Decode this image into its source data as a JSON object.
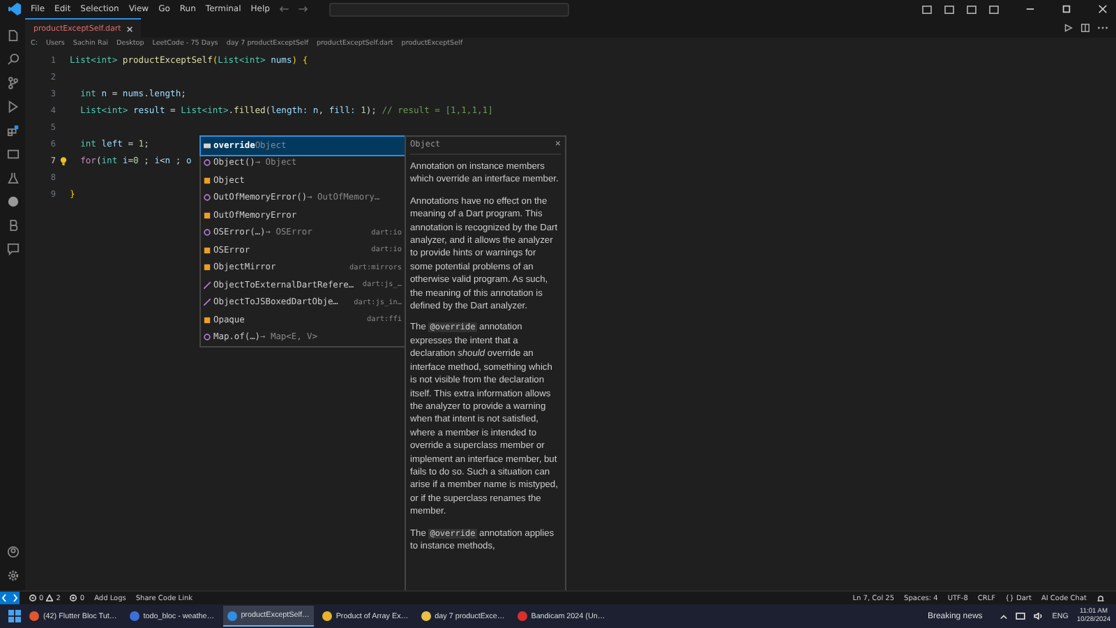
{
  "menu": [
    "File",
    "Edit",
    "Selection",
    "View",
    "Go",
    "Run",
    "Terminal",
    "Help"
  ],
  "tabs": [
    {
      "label": "productExceptSelf.dart",
      "selected": true
    }
  ],
  "breadcrumb": [
    "C:",
    "Users",
    "Sachin Rai",
    "Desktop",
    "LeetCode - 75 Days",
    "day 7 productExceptSelf",
    "productExceptSelf.dart",
    "productExceptSelf"
  ],
  "code": [
    {
      "number": "1",
      "tokens": [
        {
          "kind": "type",
          "text": "List<int> "
        },
        {
          "kind": "fn",
          "text": "productExceptSelf"
        },
        {
          "kind": "punct",
          "text": "("
        },
        {
          "kind": "type",
          "text": "List<int>"
        },
        {
          "kind": "var",
          "text": " nums"
        },
        {
          "kind": "punct",
          "text": ") {"
        }
      ]
    },
    {
      "number": "2"
    },
    {
      "number": "3",
      "indent": true,
      "tokens": [
        {
          "kind": "type",
          "text": "int"
        },
        {
          "kind": "var",
          "text": " n"
        },
        {
          "kind": "plain",
          "text": " = "
        },
        {
          "kind": "var",
          "text": "nums"
        },
        {
          "kind": "plain",
          "text": "."
        },
        {
          "kind": "var",
          "text": "length"
        },
        {
          "kind": "plain",
          "text": ";"
        }
      ]
    },
    {
      "number": "4",
      "indent": true,
      "tokens": [
        {
          "kind": "type",
          "text": "List<int>"
        },
        {
          "kind": "var",
          "text": " result"
        },
        {
          "kind": "plain",
          "text": " = "
        },
        {
          "kind": "type",
          "text": "List<int>"
        },
        {
          "kind": "plain",
          "text": "."
        },
        {
          "kind": "fn",
          "text": "filled"
        },
        {
          "kind": "plain",
          "text": "("
        },
        {
          "kind": "var",
          "text": "length:"
        },
        {
          "kind": "var",
          "text": " n"
        },
        {
          "kind": "plain",
          "text": ", "
        },
        {
          "kind": "var",
          "text": "fill:"
        },
        {
          "kind": "num",
          "text": " 1"
        },
        {
          "kind": "plain",
          "text": "); "
        },
        {
          "kind": "comment",
          "text": "// result = [1,1,1,1]"
        }
      ]
    },
    {
      "number": "5"
    },
    {
      "number": "6",
      "indent": true,
      "tokens": [
        {
          "kind": "type",
          "text": "int"
        },
        {
          "kind": "var",
          "text": " left"
        },
        {
          "kind": "plain",
          "text": " = "
        },
        {
          "kind": "num",
          "text": "1"
        },
        {
          "kind": "plain",
          "text": ";"
        }
      ]
    },
    {
      "number": "7",
      "indent": true,
      "current": true,
      "tokens": [
        {
          "kind": "kw",
          "text": "for"
        },
        {
          "kind": "plain",
          "text": "("
        },
        {
          "kind": "type",
          "text": "int"
        },
        {
          "kind": "var",
          "text": " i"
        },
        {
          "kind": "plain",
          "text": "="
        },
        {
          "kind": "num",
          "text": "0"
        },
        {
          "kind": "plain",
          "text": " ; "
        },
        {
          "kind": "var",
          "text": "i"
        },
        {
          "kind": "plain",
          "text": "<"
        },
        {
          "kind": "var",
          "text": "n"
        },
        {
          "kind": "plain",
          "text": " ; "
        },
        {
          "kind": "var",
          "text": "o"
        }
      ]
    },
    {
      "number": "8"
    },
    {
      "number": "9",
      "tokens": [
        {
          "kind": "punct",
          "text": "}"
        }
      ]
    }
  ],
  "suggestions": [
    {
      "kind": "keyword",
      "label": "override",
      "signature": "Object",
      "selected": true
    },
    {
      "kind": "constructor",
      "label": "Object()",
      "signature": "→ Object",
      "selected": false
    },
    {
      "kind": "class",
      "label": "Object",
      "selected": false
    },
    {
      "kind": "constructor",
      "label": "OutOfMemoryError()",
      "signature": "→ OutOfMemory…",
      "selected": false
    },
    {
      "kind": "class",
      "label": "OutOfMemoryError",
      "selected": false
    },
    {
      "kind": "constructor",
      "label": "OSError(…)",
      "signature": "→ OSError",
      "detail": "dart:io",
      "selected": false
    },
    {
      "kind": "class",
      "label": "OSError",
      "detail": "dart:io",
      "selected": false
    },
    {
      "kind": "class",
      "label": "ObjectMirror",
      "detail": "dart:mirrors",
      "selected": false
    },
    {
      "kind": "function",
      "label": "ObjectToExternalDartRefere…",
      "detail": "dart:js_…",
      "selected": false
    },
    {
      "kind": "function",
      "label": "ObjectToJSBoxedDartObje…",
      "detail": "dart:js_in…",
      "selected": false
    },
    {
      "kind": "class",
      "label": "Opaque",
      "detail": "dart:ffi",
      "selected": false
    },
    {
      "kind": "constructor",
      "label": "Map.of(…)",
      "signature": "→ Map<E, V>",
      "selected": false
    }
  ],
  "doc": {
    "title": "Object",
    "close": "×",
    "paragraphs": [
      [
        {
          "kind": "text",
          "text": "Annotation on instance members which override an interface member."
        }
      ],
      [
        {
          "kind": "text",
          "text": "Annotations have no effect on the meaning of a Dart program. This annotation is recognized by the Dart analyzer, and it allows the analyzer to provide hints or warnings for some potential problems of an otherwise valid program. As such, the meaning of this annotation is defined by the Dart analyzer."
        }
      ],
      [
        {
          "kind": "text",
          "text": "The "
        },
        {
          "kind": "code",
          "text": "@override"
        },
        {
          "kind": "text",
          "text": " annotation expresses the intent that a declaration *should* override an interface method, something which is not visible from the declaration itself. This extra information allows the analyzer to provide a warning when that intent is not satisfied, where a member is intended to override a superclass member or implement an interface member, but fails to do so. Such a situation can arise if a member name is mistyped, or if the superclass renames the member."
        }
      ],
      [
        {
          "kind": "text",
          "text": "The "
        },
        {
          "kind": "code",
          "text": "@override"
        },
        {
          "kind": "text",
          "text": " annotation applies to instance methods,"
        }
      ]
    ]
  },
  "status_left": [
    {
      "kind": "problems",
      "errors": "0",
      "warnings": "2"
    },
    {
      "kind": "ports",
      "text": "0"
    },
    {
      "kind": "text",
      "text": "Add Logs"
    },
    {
      "kind": "text",
      "text": "Share Code Link"
    }
  ],
  "status_right": [
    "Ln 7, Col 25",
    "Spaces: 4",
    "UTF-8",
    "CRLF",
    "{} Dart",
    "AI Code Chat"
  ],
  "taskbar": [
    {
      "label": "(42) Flutter Bloc Tut…",
      "color": "#e0562e",
      "selected": false
    },
    {
      "label": "todo_bloc - weathe…",
      "color": "#3c6fd8",
      "selected": false
    },
    {
      "label": "productExceptSelf…",
      "color": "#2f8fe0",
      "selected": true
    },
    {
      "label": "Product of Array Ex…",
      "color": "#e8b32a",
      "selected": false
    },
    {
      "label": "day 7 productExce…",
      "color": "#e8c04a",
      "selected": false
    },
    {
      "label": "Bandicam 2024 (Un…",
      "color": "#d9302c",
      "selected": false
    }
  ],
  "tray": {
    "news": "Breaking news",
    "lang": "ENG",
    "time": "11:01 AM",
    "date": "10/28/2024"
  }
}
